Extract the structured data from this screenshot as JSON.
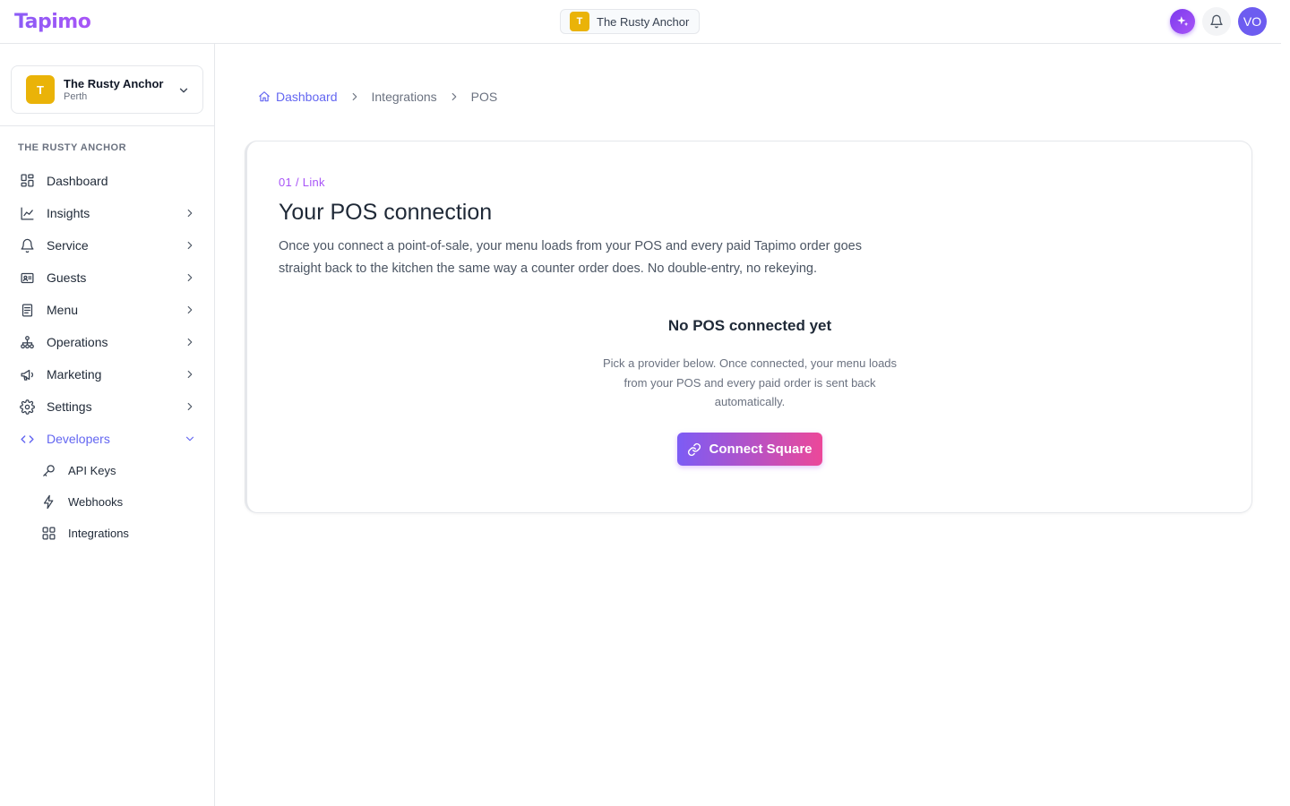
{
  "app": {
    "logo_text": "Tapimo"
  },
  "topbar": {
    "venue_initial": "T",
    "venue_name": "The Rusty Anchor",
    "avatar_initials": "VO"
  },
  "sidebar": {
    "venue": {
      "initial": "T",
      "name": "The Rusty Anchor",
      "city": "Perth"
    },
    "section_label": "THE RUSTY ANCHOR",
    "items": [
      {
        "label": "Dashboard",
        "icon": "dashboard-icon"
      },
      {
        "label": "Insights",
        "icon": "chart-icon"
      },
      {
        "label": "Service",
        "icon": "bell-icon"
      },
      {
        "label": "Guests",
        "icon": "contact-card-icon"
      },
      {
        "label": "Menu",
        "icon": "document-icon"
      },
      {
        "label": "Operations",
        "icon": "org-chart-icon"
      },
      {
        "label": "Marketing",
        "icon": "megaphone-icon"
      },
      {
        "label": "Settings",
        "icon": "gear-icon"
      },
      {
        "label": "Developers",
        "icon": "code-icon"
      }
    ],
    "sub_items": [
      {
        "label": "API Keys",
        "icon": "key-icon"
      },
      {
        "label": "Webhooks",
        "icon": "lightning-icon"
      },
      {
        "label": "Integrations",
        "icon": "grid-icon"
      }
    ]
  },
  "breadcrumb": {
    "home": "Dashboard",
    "middle": "Integrations",
    "current": "POS"
  },
  "card": {
    "step": "01 / Link",
    "title": "Your POS connection",
    "description": "Once you connect a point-of-sale, your menu loads from your POS and every paid Tapimo order goes straight back to the kitchen the same way a counter order does. No double-entry, no rekeying.",
    "empty_title": "No POS connected yet",
    "empty_description": "Pick a provider below. Once connected, your menu loads from your POS and every paid order is sent back automatically.",
    "connect_button": "Connect Square"
  },
  "colors": {
    "brand": "#8b5cf6",
    "accent": "#6366f1",
    "venue_badge": "#eab308",
    "button_gradient_start": "#7c5cf5",
    "button_gradient_end": "#ec4899"
  }
}
